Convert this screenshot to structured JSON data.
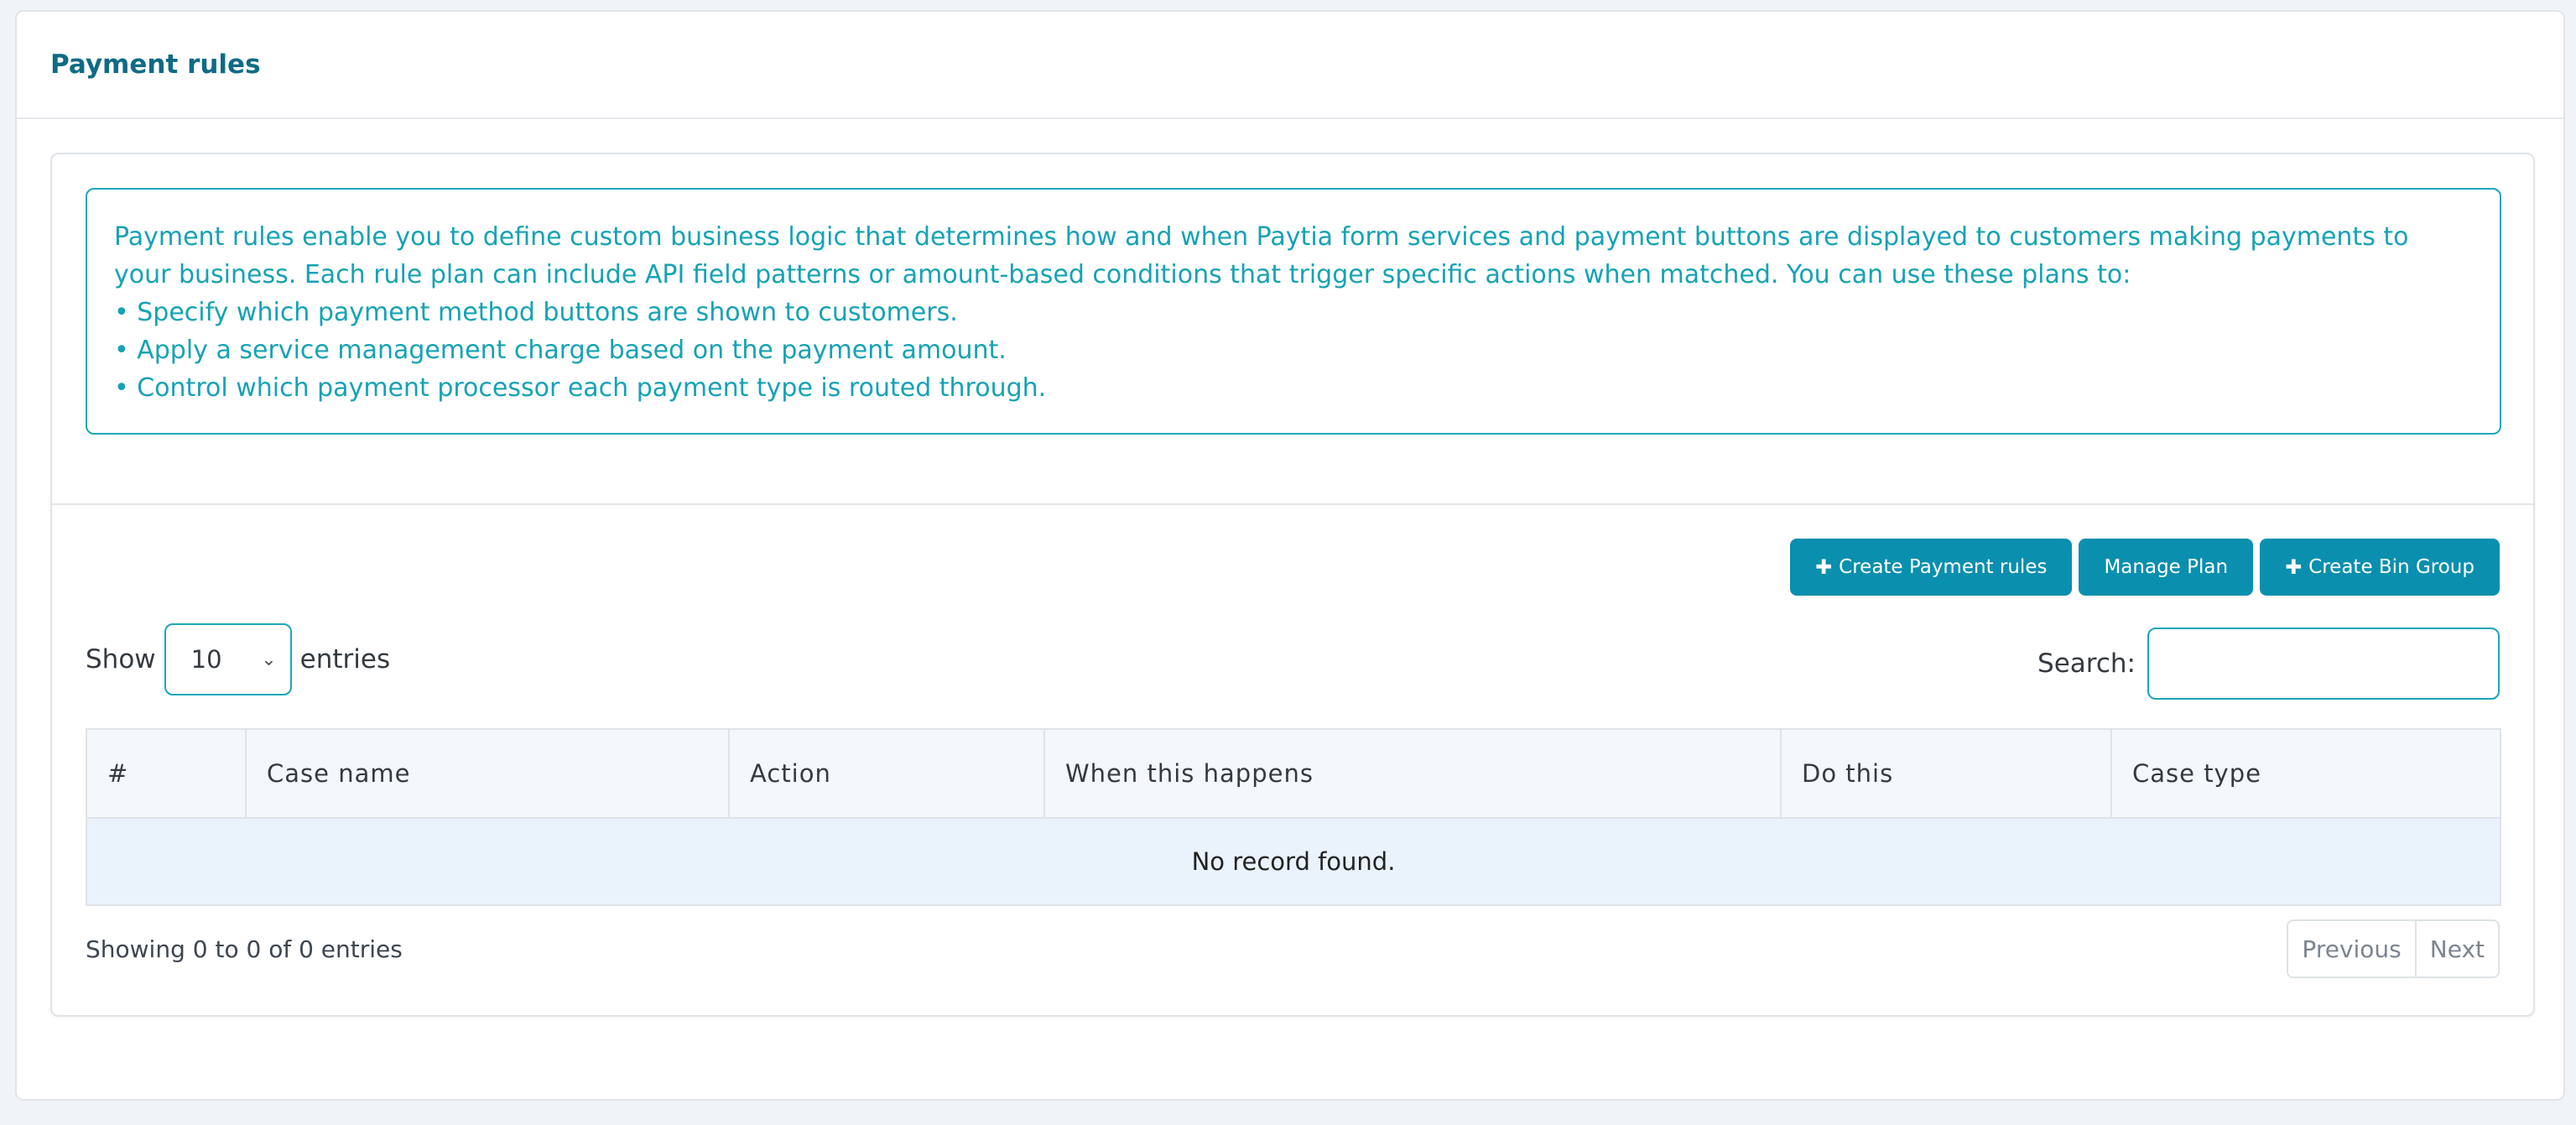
{
  "page": {
    "title": "Payment rules"
  },
  "info": {
    "intro": "Payment rules enable you to define custom business logic that determines how and when Paytia form services and payment buttons are displayed to customers making payments to your business. Each rule plan can include API field patterns or amount-based conditions that trigger specific actions when matched. You can use these plans to:",
    "bullets": [
      "Specify which payment method buttons are shown to customers.",
      "Apply a service management charge based on the payment amount.",
      "Control which payment processor each payment type is routed through."
    ]
  },
  "toolbar": {
    "create_rules_label": "Create Payment rules",
    "manage_plan_label": "Manage Plan",
    "create_bin_group_label": "Create Bin Group"
  },
  "length": {
    "prefix": "Show",
    "selected": "10",
    "suffix": "entries"
  },
  "search": {
    "label": "Search:",
    "value": ""
  },
  "table": {
    "columns": [
      "#",
      "Case name",
      "Action",
      "When this happens",
      "Do this",
      "Case type"
    ],
    "empty_message": "No record found."
  },
  "footer": {
    "info": "Showing 0 to 0 of 0 entries",
    "previous": "Previous",
    "next": "Next"
  },
  "colors": {
    "accent": "#0a8fae",
    "info_text": "#16a2b5",
    "title": "#0e6b86"
  }
}
